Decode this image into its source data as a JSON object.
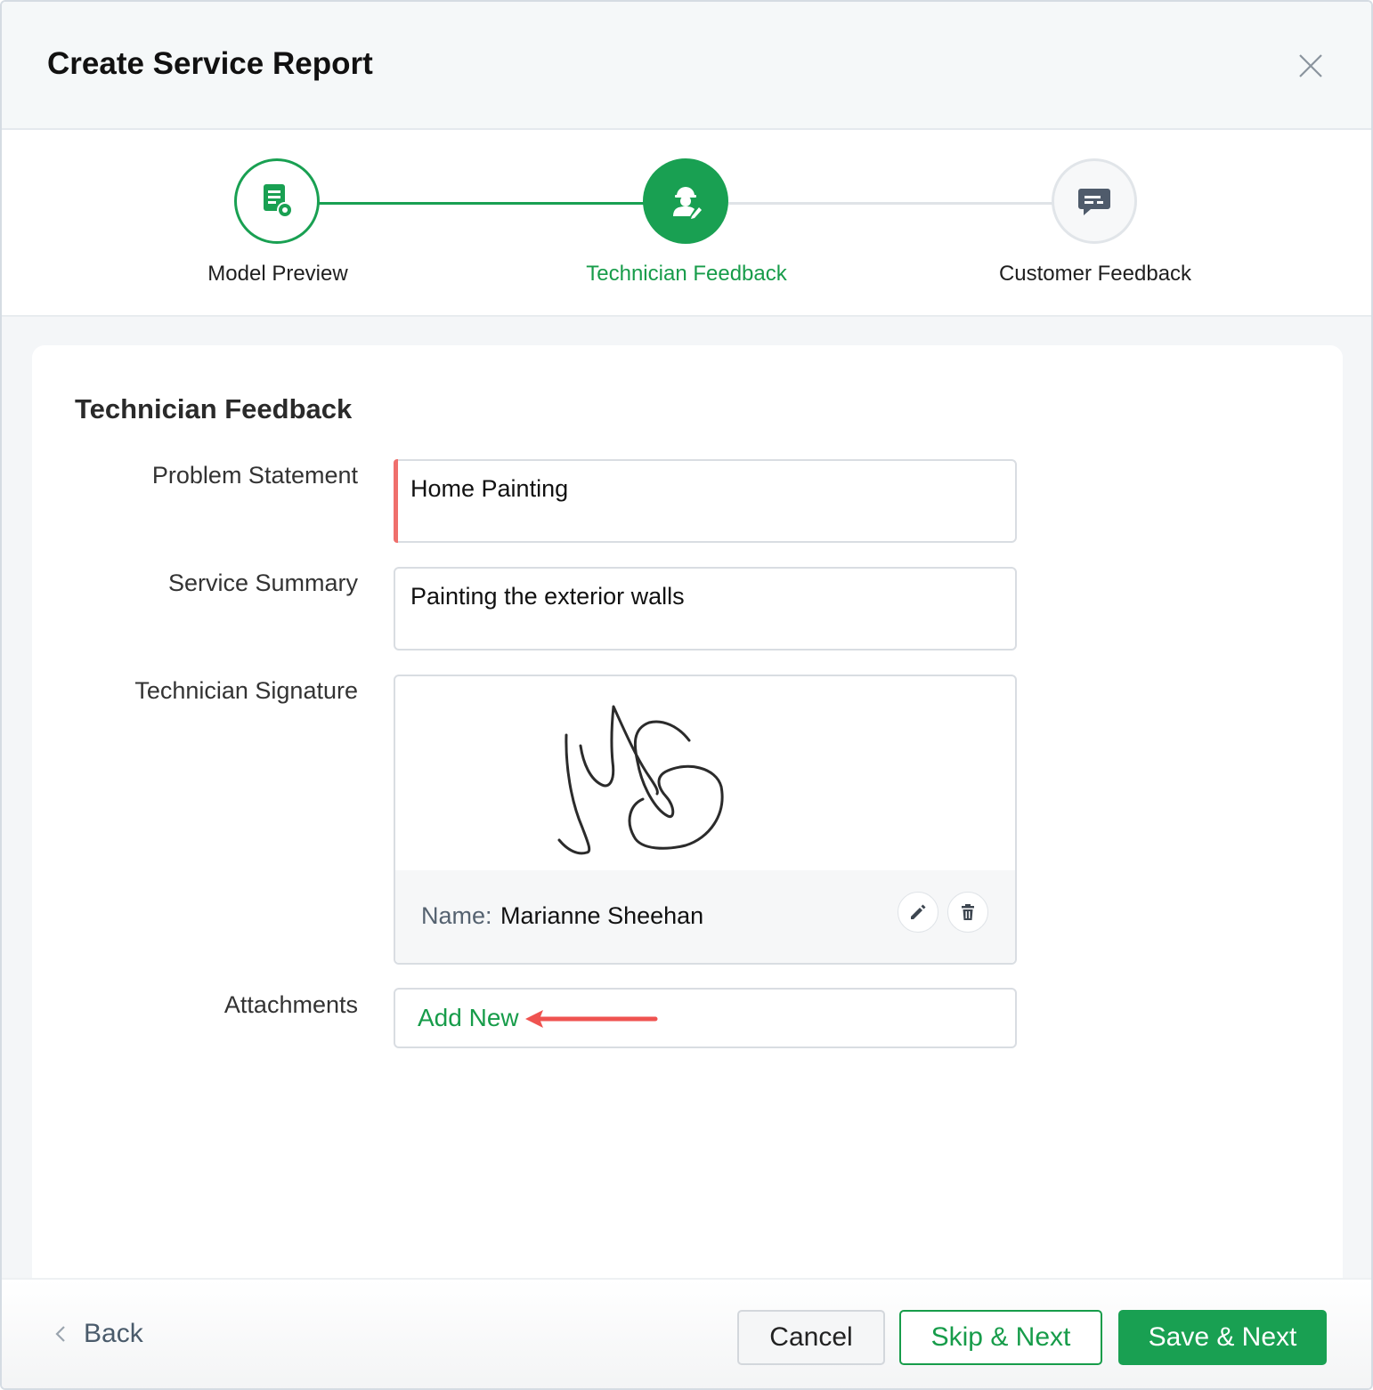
{
  "dialog": {
    "title": "Create Service Report",
    "close_icon": "close-icon"
  },
  "stepper": {
    "steps": [
      {
        "label": "Model Preview",
        "icon": "document-settings-icon",
        "state": "completed"
      },
      {
        "label": "Technician Feedback",
        "icon": "technician-icon",
        "state": "active"
      },
      {
        "label": "Customer Feedback",
        "icon": "chat-bubble-icon",
        "state": "pending"
      }
    ]
  },
  "form": {
    "section_title": "Technician Feedback",
    "problem_statement": {
      "label": "Problem Statement",
      "value": "Home Painting"
    },
    "service_summary": {
      "label": "Service Summary",
      "value": "Painting the exterior walls"
    },
    "technician_signature": {
      "label": "Technician Signature",
      "name_label": "Name:",
      "name_value": "Marianne Sheehan"
    },
    "attachments": {
      "label": "Attachments",
      "add_new_label": "Add New"
    }
  },
  "footer": {
    "back_label": "Back",
    "cancel_label": "Cancel",
    "skip_label": "Skip & Next",
    "save_label": "Save & Next"
  },
  "colors": {
    "accent": "#19a052",
    "required": "#ef6f6c",
    "annotation_arrow": "#ef5350"
  }
}
